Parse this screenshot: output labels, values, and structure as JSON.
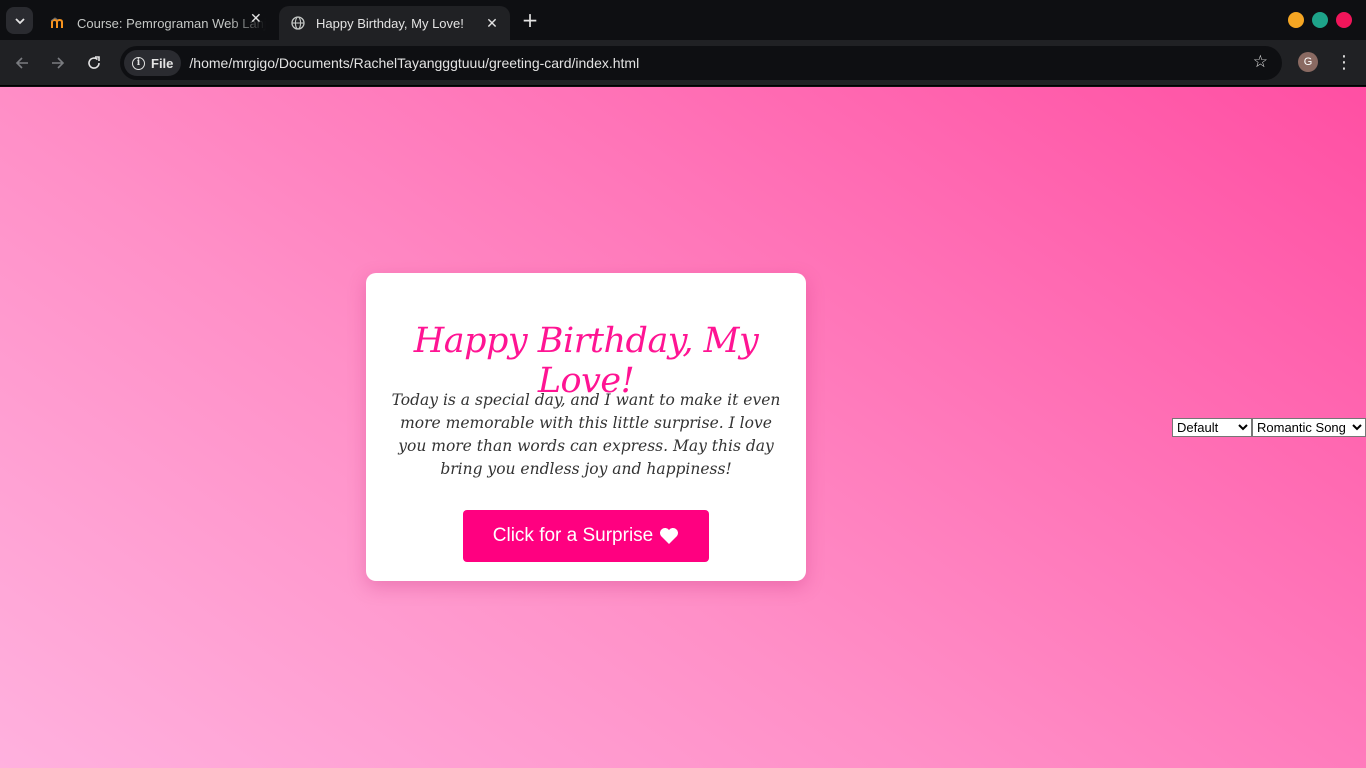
{
  "browser": {
    "tabs": [
      {
        "title": "Course: Pemrograman Web Lanjut",
        "favicon": "moodle-icon",
        "active": false
      },
      {
        "title": "Happy Birthday, My Love!",
        "favicon": "globe-icon",
        "active": true
      }
    ],
    "new_tab_icon": "plus-icon",
    "window_controls": {
      "colors": [
        "#f5a623",
        "#1ea48a",
        "#f0155a"
      ]
    },
    "toolbar": {
      "back_icon": "arrow-left-icon",
      "forward_icon": "arrow-right-icon",
      "reload_icon": "reload-icon",
      "security_chip_label": "File",
      "url": "/home/mrgigo/Documents/RachelTayangggtuuu/greeting-card/index.html",
      "bookmark_icon": "star-icon",
      "profile_initial": "G",
      "menu_icon": "kebab-menu-icon"
    }
  },
  "page": {
    "background_colors": [
      "#ffb1de",
      "#ff4fa3"
    ],
    "card": {
      "title": "Happy Birthday, My Love!",
      "message": "Today is a special day, and I want to make it even more memorable with this little surprise. I love you more than words can express. May this day bring you endless joy and happiness!",
      "button_label": "Click for a Surprise",
      "button_icon": "heart-icon",
      "title_color": "#ff1493",
      "button_color": "#ff0080"
    },
    "theme_select": {
      "selected": "Default"
    },
    "song_select": {
      "selected": "Romantic Song"
    }
  }
}
